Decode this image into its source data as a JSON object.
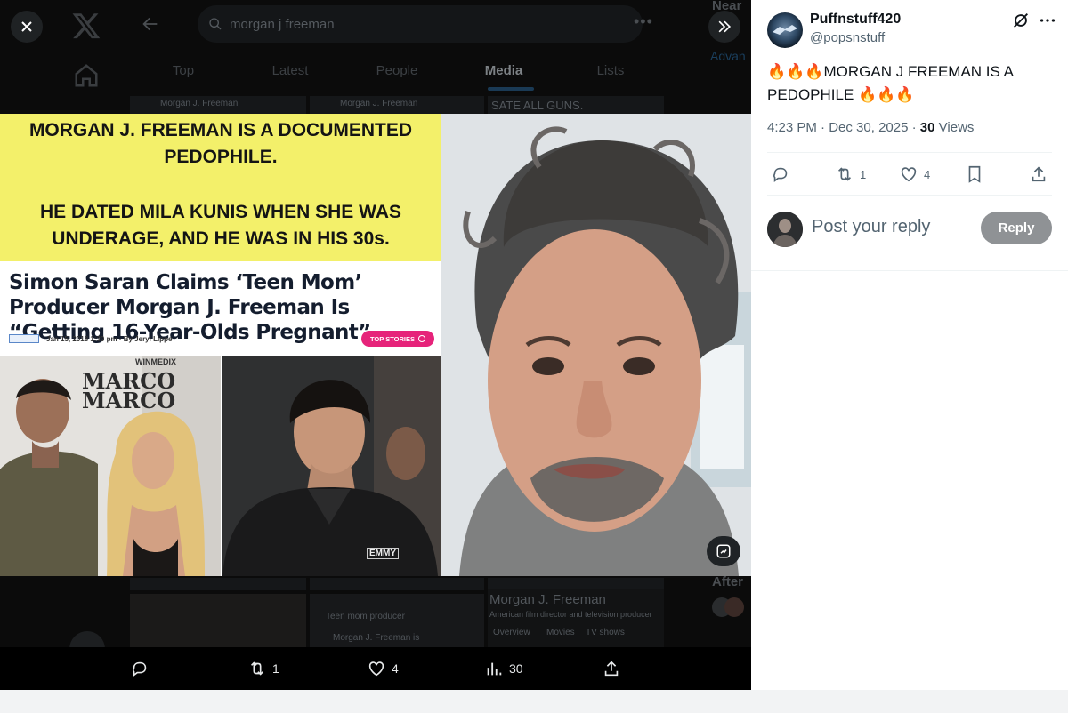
{
  "background": {
    "search_query": "morgan j freeman",
    "tabs": [
      "Top",
      "Latest",
      "People",
      "Media",
      "Lists"
    ],
    "active_tab": "Media",
    "right_rail": {
      "near": "Near",
      "advanced": "Advan",
      "after": "After"
    },
    "thumb_captions": {
      "top_left": "Morgan J. Freeman",
      "top_mid": "Morgan J. Freeman",
      "top_right": "SATE ALL GUNS.",
      "bottom_left": "Teen mom producer",
      "bottom_left2": "Morgan J. Freeman is",
      "profile_name": "Morgan J. Freeman",
      "profile_desc": "American film director and television producer",
      "chips": [
        "Overview",
        "Movies",
        "TV shows"
      ]
    }
  },
  "media": {
    "yellow_line1": "MORGAN J. FREEMAN IS A DOCUMENTED",
    "yellow_line2": "PEDOPHILE.",
    "yellow_line3": "HE DATED MILA KUNIS WHEN SHE WAS",
    "yellow_line4": "UNDERAGE, AND HE WAS IN HIS 30s.",
    "headline": "Simon Saran Claims ‘Teen Mom’ Producer Morgan J. Freeman Is “Getting 16-Year-Olds Pregnant”",
    "byline": "Jan 15, 2018 1:30 pm · By Jeryl Lippe",
    "badge": "TOP STORIES",
    "backdrop_text": "MARCO MARCO",
    "wire_text": "WINMEDIX",
    "shirt_text": "EMMY"
  },
  "media_actions": {
    "retweets": "1",
    "likes": "4",
    "views": "30"
  },
  "tweet": {
    "display_name": "Puffnstuff420",
    "handle": "@popsnstuff",
    "emoji_fire": "🔥🔥🔥",
    "text_main": "MORGAN J FREEMAN IS A PEDOPHILE",
    "time": "4:23 PM",
    "date": "Dec 30, 2025",
    "views_count": "30",
    "views_label": "Views",
    "retweets": "1",
    "likes": "4",
    "reply_placeholder": "Post your reply",
    "reply_button": "Reply"
  },
  "colors": {
    "accent": "#1d9bf0",
    "reply_button_bg": "#8f9295",
    "yellow_banner": "#f3f06a",
    "badge_pink": "#e6237a"
  },
  "icons": [
    "close-icon",
    "x-logo-icon",
    "home-icon",
    "back-arrow-icon",
    "search-icon",
    "more-icon",
    "expand-icon",
    "reply-icon",
    "retweet-icon",
    "like-icon",
    "views-icon",
    "share-icon",
    "bookmark-icon",
    "grok-icon",
    "edit-image-icon"
  ]
}
